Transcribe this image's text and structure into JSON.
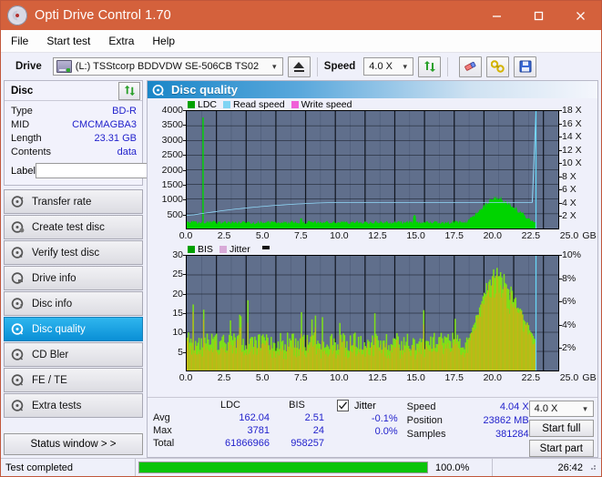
{
  "window": {
    "title": "Opti Drive Control 1.70",
    "app_icon": "disc-icon",
    "minimize": "—",
    "maximize": "□",
    "close": "✕"
  },
  "menu": {
    "items": [
      "File",
      "Start test",
      "Extra",
      "Help"
    ]
  },
  "toolbar": {
    "drive_label": "Drive",
    "drive_value": "(L:)  TSStcorp BDDVDW SE-506CB TS02",
    "eject_icon": "eject-icon",
    "speed_label": "Speed",
    "speed_value": "4.0 X",
    "refresh_icon": "refresh-icon",
    "erase_icon": "eraser-icon",
    "tools_icon": "wrench-icon",
    "save_icon": "floppy-save-icon"
  },
  "disc": {
    "title": "Disc",
    "refresh_icon": "refresh-icon",
    "rows": [
      {
        "key": "Type",
        "value": "BD-R"
      },
      {
        "key": "MID",
        "value": "CMCMAGBA3"
      },
      {
        "key": "Length",
        "value": "23.31 GB"
      },
      {
        "key": "Contents",
        "value": "data"
      }
    ],
    "label_key": "Label",
    "label_value": "",
    "label_placeholder": "",
    "label_button_icon": "disc-icon"
  },
  "sidebar": {
    "tabs": [
      {
        "label": "Transfer rate",
        "icon": "disc-speed-icon",
        "active": false
      },
      {
        "label": "Create test disc",
        "icon": "disc-write-icon",
        "active": false
      },
      {
        "label": "Verify test disc",
        "icon": "disc-verify-icon",
        "active": false
      },
      {
        "label": "Drive info",
        "icon": "drive-info-icon",
        "active": false
      },
      {
        "label": "Disc info",
        "icon": "disc-info-icon",
        "active": false
      },
      {
        "label": "Disc quality",
        "icon": "disc-quality-icon",
        "active": true
      },
      {
        "label": "CD Bler",
        "icon": "disc-bler-icon",
        "active": false
      },
      {
        "label": "FE / TE",
        "icon": "disc-fete-icon",
        "active": false
      },
      {
        "label": "Extra tests",
        "icon": "disc-extra-icon",
        "active": false
      }
    ],
    "status_window_button": "Status window > >"
  },
  "panel": {
    "title": "Disc quality",
    "title_icon": "disc-quality-icon"
  },
  "chart_data": [
    {
      "type": "area",
      "name": "ldc-chart",
      "title": "",
      "xlabel": "GB",
      "ylabel": "",
      "legend": [
        {
          "label": "LDC",
          "color": "#00a000"
        },
        {
          "label": "Read speed",
          "color": "#7fd4f4"
        },
        {
          "label": "Write speed",
          "color": "#f060d8"
        }
      ],
      "xlim": [
        0,
        25
      ],
      "xticks": [
        "0.0",
        "2.5",
        "5.0",
        "7.5",
        "10.0",
        "12.5",
        "15.0",
        "17.5",
        "20.0",
        "22.5",
        "25.0"
      ],
      "xunit": "GB",
      "ylim": [
        0,
        4000
      ],
      "yticks": [
        "4000",
        "3500",
        "3000",
        "2500",
        "2000",
        "1500",
        "1000",
        "500"
      ],
      "y2lim": [
        0,
        18
      ],
      "y2ticks": [
        "18 X",
        "16 X",
        "14 X",
        "12 X",
        "10 X",
        "8 X",
        "6 X",
        "4 X",
        "2 X"
      ],
      "grid": true,
      "series": [
        {
          "name": "LDC",
          "color": "#00cc00",
          "type": "area",
          "note": "dense noise floor ~120-260, one spike to 3781 near 1.1 GB, broad elevated hump 19-22.5 GB peaking ~950",
          "values": [
            180,
            170,
            3781,
            200,
            190,
            185,
            175,
            180,
            190,
            200,
            185,
            175,
            180,
            190,
            185,
            180,
            175,
            185,
            190,
            180,
            175,
            180,
            185,
            195,
            180,
            175,
            185,
            190,
            180,
            175,
            180,
            190,
            185,
            180,
            175,
            185,
            190,
            200,
            185,
            175,
            180,
            190,
            185,
            195,
            180,
            175,
            185,
            190,
            180,
            175,
            185,
            195,
            180,
            175,
            190,
            185,
            180,
            195,
            185,
            175,
            180,
            190,
            200,
            185,
            175,
            180,
            195,
            185,
            180,
            190,
            175,
            185,
            195,
            180,
            190,
            185,
            175,
            180,
            190,
            200,
            260,
            320,
            430,
            560,
            690,
            820,
            905,
            950,
            920,
            870,
            830,
            790,
            740,
            690,
            640,
            560,
            470,
            380,
            300,
            0
          ]
        },
        {
          "name": "Read speed",
          "color": "#8fd8f8",
          "type": "line",
          "note": "ramps from ~2.0X at 0 GB to 4.0X near 14 GB, flat 4.0X until 23.5 GB then vertical drop marker",
          "values": [
            2.0,
            2.05,
            2.1,
            2.2,
            2.28,
            2.35,
            2.45,
            2.52,
            2.6,
            2.68,
            2.75,
            2.82,
            2.9,
            2.96,
            3.02,
            3.08,
            3.14,
            3.2,
            3.26,
            3.3,
            3.36,
            3.4,
            3.45,
            3.5,
            3.54,
            3.58,
            3.62,
            3.66,
            3.7,
            3.73,
            3.76,
            3.79,
            3.82,
            3.85,
            3.88,
            3.9,
            3.92,
            3.94,
            3.96,
            3.98,
            4.0,
            4.0,
            4.0,
            4.0,
            4.0,
            4.0,
            4.0,
            4.0,
            4.0,
            4.0,
            4.0,
            4.0,
            4.0,
            4.0,
            4.0,
            4.0,
            4.0,
            4.0,
            4.0,
            4.0,
            4.0,
            4.0,
            4.0,
            4.0,
            4.0,
            4.0,
            4.0,
            4.0,
            4.0,
            4.0,
            4.0,
            4.0,
            4.0,
            4.0,
            4.0,
            4.0,
            4.0,
            4.0,
            4.0,
            4.0,
            4.0,
            4.0,
            4.0,
            4.0,
            4.0,
            4.0,
            4.0,
            4.0,
            4.0,
            4.0,
            4.0,
            4.0,
            4.0,
            4.0,
            18.0,
            0,
            0,
            0,
            0,
            0
          ]
        },
        {
          "name": "Write speed",
          "color": "#f060d8",
          "type": "line",
          "values": []
        }
      ]
    },
    {
      "type": "area",
      "name": "bis-jitter-chart",
      "title": "",
      "xlabel": "GB",
      "legend": [
        {
          "label": "BIS",
          "color": "#00a000"
        },
        {
          "label": "Jitter",
          "color": "#d8aad8"
        }
      ],
      "xlim": [
        0,
        25
      ],
      "xticks": [
        "0.0",
        "2.5",
        "5.0",
        "7.5",
        "10.0",
        "12.5",
        "15.0",
        "17.5",
        "20.0",
        "22.5",
        "25.0"
      ],
      "xunit": "GB",
      "ylim": [
        0,
        30
      ],
      "yticks": [
        "30",
        "25",
        "20",
        "15",
        "10",
        "5"
      ],
      "y2lim": [
        0,
        10
      ],
      "y2ticks": [
        "10%",
        "8%",
        "6%",
        "4%",
        "2%"
      ],
      "grid": true,
      "series": [
        {
          "name": "BIS",
          "color": "#66dd22",
          "type": "bars",
          "note": "baseline noise 5-10 with occasional spikes to 13-19; strong elevated band 19-22.5 GB reaching 20-24",
          "values": [
            9,
            12,
            14,
            10,
            11,
            13,
            9,
            10,
            12,
            19,
            11,
            10,
            9,
            12,
            15,
            10,
            9,
            11,
            10,
            12,
            9,
            10,
            11,
            9,
            10,
            12,
            9,
            10,
            11,
            9,
            10,
            13,
            9,
            10,
            11,
            9,
            12,
            10,
            9,
            11,
            10,
            9,
            12,
            10,
            9,
            11,
            10,
            13,
            9,
            10,
            14,
            9,
            10,
            11,
            9,
            12,
            10,
            9,
            11,
            10,
            9,
            12,
            16,
            10,
            9,
            11,
            10,
            12,
            9,
            10,
            13,
            9,
            11,
            10,
            9,
            12,
            10,
            9,
            11,
            14,
            17,
            20,
            22,
            24,
            23,
            21,
            22,
            20,
            19,
            18,
            17,
            15,
            13,
            12,
            11,
            10,
            15,
            9,
            0,
            0
          ]
        },
        {
          "name": "Jitter",
          "color": "#e0a000",
          "type": "bars",
          "note": "overlay peaks mirroring BIS, highest 19-22 GB region"
        }
      ]
    }
  ],
  "stats": {
    "col_headers": [
      "",
      "LDC",
      "BIS"
    ],
    "rows": [
      {
        "label": "Avg",
        "ldc": "162.04",
        "bis": "2.51"
      },
      {
        "label": "Max",
        "ldc": "3781",
        "bis": "24"
      },
      {
        "label": "Total",
        "ldc": "61866966",
        "bis": "958257"
      }
    ],
    "jitter": {
      "label": "Jitter",
      "checked": true,
      "avg": "-0.1%",
      "max": "0.0%"
    },
    "right": [
      {
        "key": "Speed",
        "value": "4.04 X"
      },
      {
        "key": "Position",
        "value": "23862 MB"
      },
      {
        "key": "Samples",
        "value": "381284"
      }
    ],
    "speed_select": "4.0 X",
    "start_full": "Start full",
    "start_part": "Start part"
  },
  "statusbar": {
    "message": "Test completed",
    "progress_percent": 100.0,
    "progress_text": "100.0%",
    "elapsed": "26:42"
  },
  "colors": {
    "titlebar": "#d4613c",
    "accent_blue": "#0a8fd6",
    "plot_bg": "#606f8c",
    "value_text": "#2222cc",
    "progress_fill": "#0ac40a"
  }
}
